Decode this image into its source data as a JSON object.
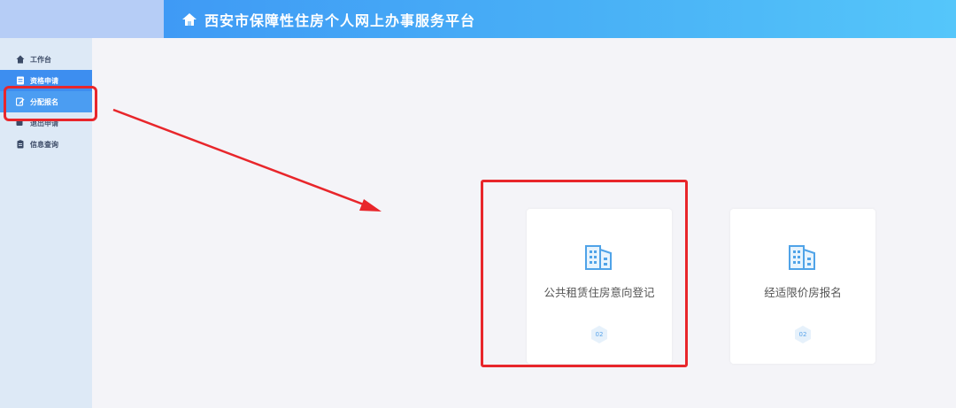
{
  "header": {
    "title": "西安市保障性住房个人网上办事服务平台"
  },
  "sidebar": {
    "items": [
      {
        "label": "工作台",
        "icon": "home-icon"
      },
      {
        "label": "资格申请",
        "icon": "document-icon"
      },
      {
        "label": "分配报名",
        "icon": "edit-icon"
      },
      {
        "label": "退出申请",
        "icon": "exit-icon"
      },
      {
        "label": "信息查询",
        "icon": "clipboard-icon"
      }
    ]
  },
  "cards": [
    {
      "label": "公共租赁住房意向登记",
      "badge": "02",
      "icon": "building-icon"
    },
    {
      "label": "经适限价房报名",
      "badge": "02",
      "icon": "building-icon"
    }
  ],
  "colors": {
    "accent": "#3d8ef0",
    "annotation": "#e8262b",
    "icon": "#4fa3e8"
  }
}
